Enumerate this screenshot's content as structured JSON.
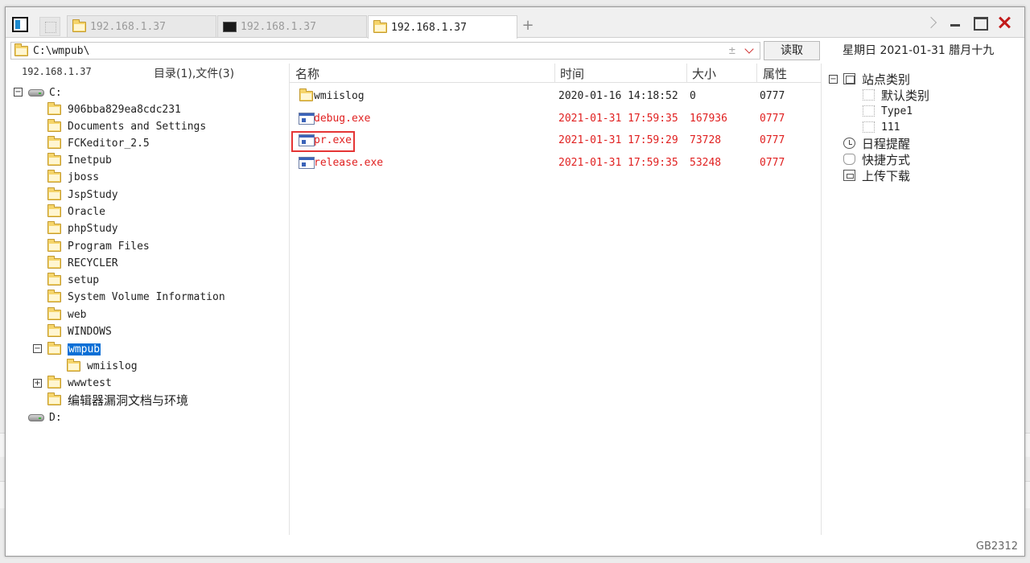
{
  "tabs": [
    {
      "label": "192.168.1.37",
      "icon": "folder-icon",
      "active": false
    },
    {
      "label": "192.168.1.37",
      "icon": "terminal-icon",
      "active": false
    },
    {
      "label": "192.168.1.37",
      "icon": "folder-icon",
      "active": true
    }
  ],
  "new_tab_label": "+",
  "address": {
    "path": "C:\\wmpub\\",
    "plusminus": "±"
  },
  "read_button": "读取",
  "date": "星期日 2021-01-31 腊月十九",
  "left_panel": {
    "host": "192.168.1.37",
    "summary": "目录(1),文件(3)"
  },
  "tree": {
    "drive_c": "C:",
    "folders": [
      "906bba829ea8cdc231",
      "Documents and Settings",
      "FCKeditor_2.5",
      "Inetpub",
      "jboss",
      "JspStudy",
      "Oracle",
      "phpStudy",
      "Program Files",
      "RECYCLER",
      "setup",
      "System Volume Information",
      "web",
      "WINDOWS"
    ],
    "selected": "wmpub",
    "selected_child": "wmiislog",
    "wwwtest": "wwwtest",
    "cjk_folder": "编辑器漏洞文档与环境",
    "drive_d": "D:",
    "expand_minus": "−",
    "expand_plus": "+"
  },
  "list": {
    "columns": [
      "名称",
      "时间",
      "大小",
      "属性"
    ],
    "rows": [
      {
        "name": "wmiislog",
        "time": "2020-01-16 14:18:52",
        "size": "0",
        "attr": "0777",
        "type": "folder"
      },
      {
        "name": "debug.exe",
        "time": "2021-01-31 17:59:35",
        "size": "167936",
        "attr": "0777",
        "type": "exe"
      },
      {
        "name": "pr.exe",
        "time": "2021-01-31 17:59:29",
        "size": "73728",
        "attr": "0777",
        "type": "exe"
      },
      {
        "name": "release.exe",
        "time": "2021-01-31 17:59:35",
        "size": "53248",
        "attr": "0777",
        "type": "exe"
      }
    ]
  },
  "right_tree": {
    "root": "站点类别",
    "categories": [
      "默认类别",
      "Type1",
      "111"
    ],
    "schedule": "日程提醒",
    "shortcuts": "快捷方式",
    "transfer": "上传下载",
    "collapse": "−"
  },
  "encoding": "GB2312",
  "colors": {
    "accent_blue": "#0a6fd6",
    "exe_red": "#e02020",
    "highlight_red": "#e53535"
  }
}
